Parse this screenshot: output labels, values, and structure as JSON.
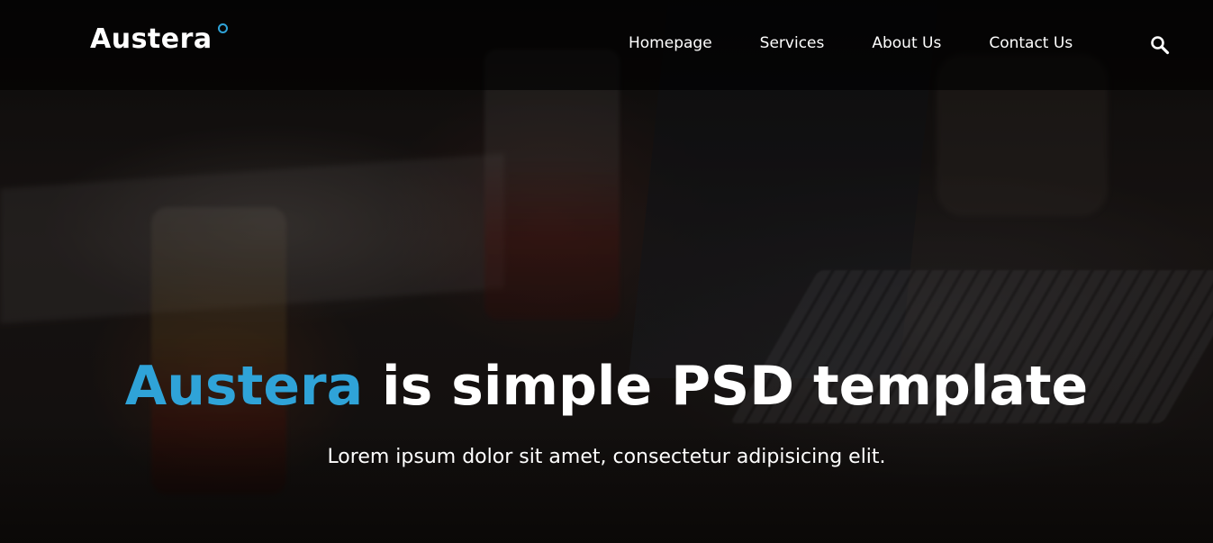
{
  "brand": {
    "name": "Austera",
    "accent_color": "#2fa3d8"
  },
  "nav": {
    "items": [
      {
        "label": "Homepage"
      },
      {
        "label": "Services"
      },
      {
        "label": "About Us"
      },
      {
        "label": "Contact Us"
      }
    ],
    "search_icon": "search-icon"
  },
  "hero": {
    "headline_accent": "Austera",
    "headline_rest": " is simple PSD template",
    "subtitle": "Lorem ipsum dolor sit amet, consectetur adipisicing elit."
  }
}
